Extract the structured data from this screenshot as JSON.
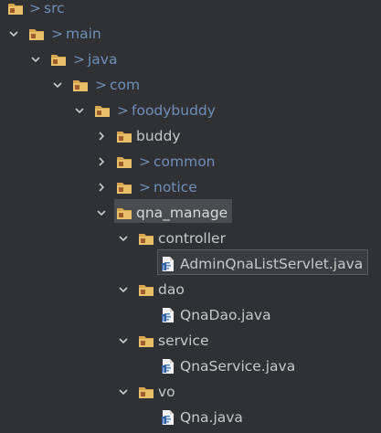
{
  "tree": {
    "items": [
      {
        "label": "src",
        "prefix": ">"
      },
      {
        "label": "main",
        "prefix": ">"
      },
      {
        "label": "java",
        "prefix": ">"
      },
      {
        "label": "com",
        "prefix": ">"
      },
      {
        "label": "foodybuddy",
        "prefix": ">"
      },
      {
        "label": "buddy"
      },
      {
        "label": "common",
        "prefix": ">"
      },
      {
        "label": "notice",
        "prefix": ">"
      },
      {
        "label": "qna_manage"
      },
      {
        "label": "controller"
      },
      {
        "label": "AdminQnaListServlet.java"
      },
      {
        "label": "dao"
      },
      {
        "label": "QnaDao.java"
      },
      {
        "label": "service"
      },
      {
        "label": "QnaService.java"
      },
      {
        "label": "vo"
      },
      {
        "label": "Qna.java"
      }
    ]
  },
  "colors": {
    "background": "#2f3134",
    "text": "#c8c8c8",
    "modified_text": "#6f8fb8",
    "selection": "#4a4c50"
  }
}
